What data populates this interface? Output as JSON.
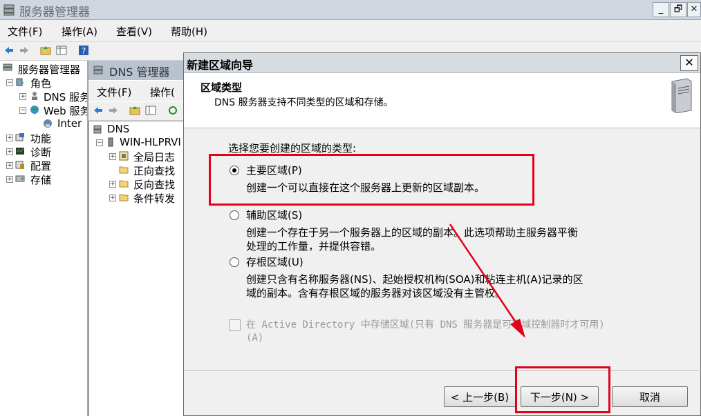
{
  "app": {
    "title": "服务器管理器",
    "window_buttons": [
      "_",
      "🗗",
      "✕"
    ]
  },
  "menu": [
    "文件(F)",
    "操作(A)",
    "查看(V)",
    "帮助(H)"
  ],
  "left_tree": {
    "root": "服务器管理器",
    "roles": "角色",
    "dns": "DNS 服务",
    "web": "Web 服务",
    "inter": "Inter",
    "features": "功能",
    "diagnostics": "诊断",
    "config": "配置",
    "storage": "存储"
  },
  "dns_manager": {
    "title": "DNS 管理器",
    "menu": [
      "文件(F)",
      "操作("
    ],
    "tree": {
      "root": "DNS",
      "server": "WIN-HLPRVI",
      "global_logs": "全局日志",
      "forward": "正向查找",
      "reverse": "反向查找",
      "conditional": "条件转发"
    }
  },
  "dialog": {
    "title": "新建区域向导",
    "close": "✕",
    "header_title": "区域类型",
    "header_subtitle": "DNS 服务器支持不同类型的区域和存储。",
    "prompt": "选择您要创建的区域的类型:",
    "options": [
      {
        "label": "主要区域(P)",
        "desc": "创建一个可以直接在这个服务器上更新的区域副本。",
        "selected": true
      },
      {
        "label": "辅助区域(S)",
        "desc1": "创建一个存在于另一个服务器上的区域的副本。此选项帮助主服务器平衡",
        "desc2": "处理的工作量，并提供容错。",
        "selected": false
      },
      {
        "label": "存根区域(U)",
        "desc1": "创建只含有名称服务器(NS)、起始授权机构(SOA)和粘连主机(A)记录的区",
        "desc2": "域的副本。含有存根区域的服务器对该区域没有主管权。",
        "selected": false
      }
    ],
    "ad_checkbox_line1": "在 Active Directory 中存储区域(只有 DNS 服务器是可写域控制器时才可用)",
    "ad_checkbox_line2": "(A)",
    "buttons": {
      "back": "< 上一步(B)",
      "next": "下一步(N) >",
      "cancel": "取消"
    }
  },
  "colors": {
    "highlight": "#e4001b",
    "arrow": "#e4001b"
  }
}
